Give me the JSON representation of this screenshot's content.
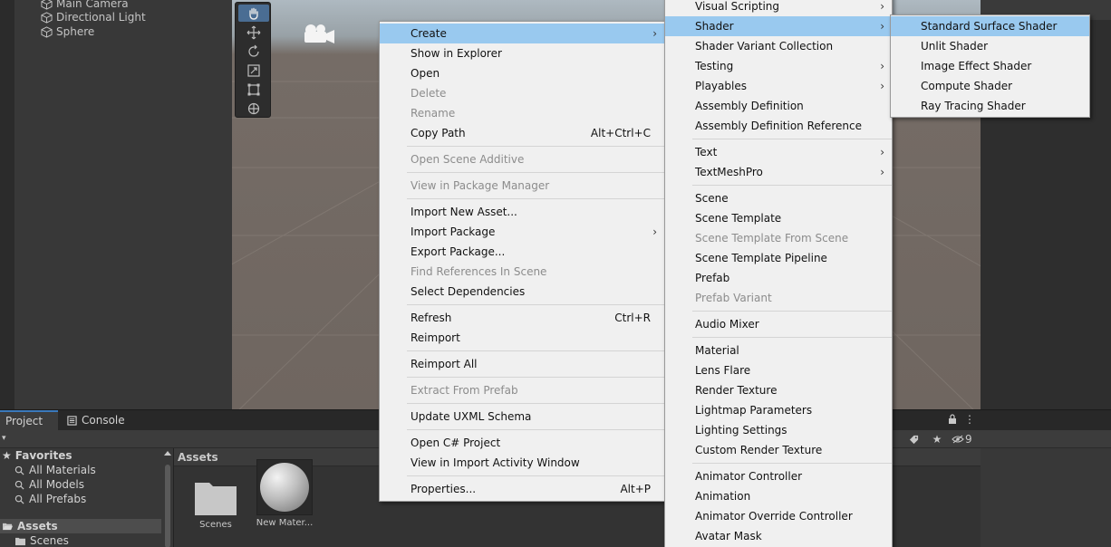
{
  "hierarchy": {
    "items": [
      "Main Camera",
      "Directional Light",
      "Sphere"
    ]
  },
  "project_panel": {
    "tabs": [
      "Project",
      "Console"
    ],
    "hidden_count": "9",
    "tree": {
      "favorites": "Favorites",
      "favorites_items": [
        "All Materials",
        "All Models",
        "All Prefabs"
      ],
      "assets": "Assets",
      "scenes": "Scenes"
    },
    "breadcrumb": "Assets",
    "assets": [
      {
        "label": "Scenes",
        "icon": "folder-icon"
      },
      {
        "label": "New Mater...",
        "icon": "material-sphere-icon"
      }
    ]
  },
  "context_menu": {
    "items": [
      {
        "label": "Create",
        "submenu": true,
        "highlighted": true
      },
      {
        "label": "Show in Explorer"
      },
      {
        "label": "Open"
      },
      {
        "label": "Delete",
        "disabled": true
      },
      {
        "label": "Rename",
        "disabled": true
      },
      {
        "label": "Copy Path",
        "shortcut": "Alt+Ctrl+C"
      },
      {
        "separator": true
      },
      {
        "label": "Open Scene Additive",
        "disabled": true
      },
      {
        "separator": true
      },
      {
        "label": "View in Package Manager",
        "disabled": true
      },
      {
        "separator": true
      },
      {
        "label": "Import New Asset..."
      },
      {
        "label": "Import Package",
        "submenu": true
      },
      {
        "label": "Export Package..."
      },
      {
        "label": "Find References In Scene",
        "disabled": true
      },
      {
        "label": "Select Dependencies"
      },
      {
        "separator": true
      },
      {
        "label": "Refresh",
        "shortcut": "Ctrl+R"
      },
      {
        "label": "Reimport"
      },
      {
        "separator": true
      },
      {
        "label": "Reimport All"
      },
      {
        "separator": true
      },
      {
        "label": "Extract From Prefab",
        "disabled": true
      },
      {
        "separator": true
      },
      {
        "label": "Update UXML Schema"
      },
      {
        "separator": true
      },
      {
        "label": "Open C# Project"
      },
      {
        "label": "View in Import Activity Window"
      },
      {
        "separator": true
      },
      {
        "label": "Properties...",
        "shortcut": "Alt+P"
      }
    ]
  },
  "create_menu": {
    "items": [
      {
        "label": "Visual Scripting",
        "submenu": true
      },
      {
        "label": "Shader",
        "submenu": true,
        "highlighted": true
      },
      {
        "label": "Shader Variant Collection"
      },
      {
        "label": "Testing",
        "submenu": true
      },
      {
        "label": "Playables",
        "submenu": true
      },
      {
        "label": "Assembly Definition"
      },
      {
        "label": "Assembly Definition Reference"
      },
      {
        "separator": true
      },
      {
        "label": "Text",
        "submenu": true
      },
      {
        "label": "TextMeshPro",
        "submenu": true
      },
      {
        "separator": true
      },
      {
        "label": "Scene"
      },
      {
        "label": "Scene Template"
      },
      {
        "label": "Scene Template From Scene",
        "disabled": true
      },
      {
        "label": "Scene Template Pipeline"
      },
      {
        "label": "Prefab"
      },
      {
        "label": "Prefab Variant",
        "disabled": true
      },
      {
        "separator": true
      },
      {
        "label": "Audio Mixer"
      },
      {
        "separator": true
      },
      {
        "label": "Material"
      },
      {
        "label": "Lens Flare"
      },
      {
        "label": "Render Texture"
      },
      {
        "label": "Lightmap Parameters"
      },
      {
        "label": "Lighting Settings"
      },
      {
        "label": "Custom Render Texture"
      },
      {
        "separator": true
      },
      {
        "label": "Animator Controller"
      },
      {
        "label": "Animation"
      },
      {
        "label": "Animator Override Controller"
      },
      {
        "label": "Avatar Mask"
      }
    ]
  },
  "shader_menu": {
    "items": [
      {
        "label": "Standard Surface Shader",
        "highlighted": true
      },
      {
        "label": "Unlit Shader"
      },
      {
        "label": "Image Effect Shader"
      },
      {
        "label": "Compute Shader"
      },
      {
        "label": "Ray Tracing Shader"
      }
    ]
  },
  "colors": {
    "menu_bg": "#f0f0f0",
    "menu_highlight": "#99c9ef",
    "disabled_text": "#8c8c8c",
    "editor_bg": "#383838",
    "accent": "#3a79bb"
  }
}
